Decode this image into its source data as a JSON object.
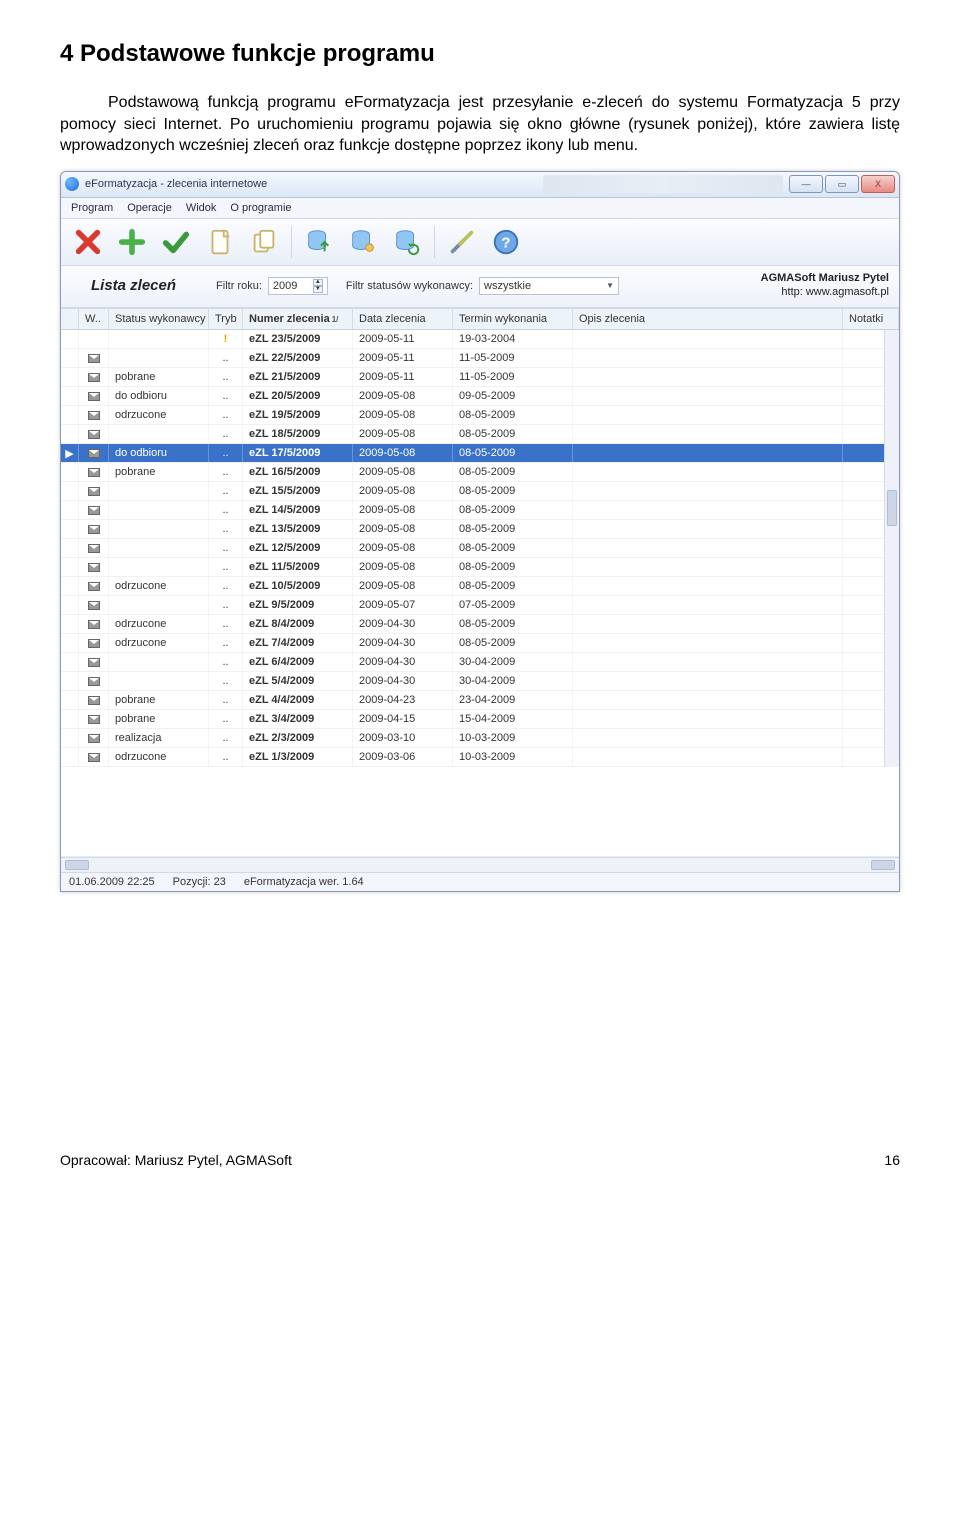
{
  "section": {
    "heading": "4  Podstawowe funkcje programu",
    "paragraph": "Podstawową funkcją programu eFormatyzacja jest przesyłanie e-zleceń do systemu Formatyzacja 5 przy pomocy sieci Internet.\nPo uruchomieniu programu pojawia się okno główne (rysunek poniżej), które zawiera listę wprowadzonych wcześniej zleceń oraz funkcje dostępne poprzez ikony lub menu."
  },
  "window": {
    "title": "eFormatyzacja - zlecenia internetowe",
    "menubar": [
      "Program",
      "Operacje",
      "Widok",
      "O programie"
    ],
    "win_buttons": {
      "min": "—",
      "max": "▭",
      "close": "X"
    },
    "toolbar_icons": [
      "close-icon",
      "add-icon",
      "confirm-icon",
      "page-icon",
      "copy-icon",
      "db-up-icon",
      "db-users-icon",
      "db-refresh-icon",
      "tools-icon",
      "help-icon"
    ],
    "filter": {
      "heading": "Lista zleceń",
      "year_label": "Filtr roku:",
      "year_value": "2009",
      "status_label": "Filtr statusów wykonawcy:",
      "status_value": "wszystkie"
    },
    "brand": {
      "name": "AGMASoft Mariusz Pytel",
      "url": "http: www.agmasoft.pl"
    },
    "columns": [
      {
        "key": "ind",
        "label": "",
        "w": "col-ind"
      },
      {
        "key": "w",
        "label": "W..",
        "w": "col-w"
      },
      {
        "key": "status",
        "label": "Status wykonawcy",
        "w": "col-status"
      },
      {
        "key": "tryb",
        "label": "Tryb",
        "w": "col-tryb"
      },
      {
        "key": "num",
        "label": "Numer zlecenia",
        "w": "col-num",
        "sort": "1/"
      },
      {
        "key": "date",
        "label": "Data zlecenia",
        "w": "col-date"
      },
      {
        "key": "term",
        "label": "Termin wykonania",
        "w": "col-term"
      },
      {
        "key": "opis",
        "label": "Opis zlecenia",
        "w": "col-opis"
      },
      {
        "key": "not",
        "label": "Notatki",
        "w": "col-not"
      }
    ],
    "rows": [
      {
        "w": "",
        "status": "",
        "trybWarn": true,
        "num": "eZL 23/5/2009",
        "date": "2009-05-11",
        "term": "19-03-2004"
      },
      {
        "w": "env",
        "status": "",
        "num": "eZL 22/5/2009",
        "date": "2009-05-11",
        "term": "11-05-2009"
      },
      {
        "w": "env",
        "status": "pobrane",
        "num": "eZL 21/5/2009",
        "date": "2009-05-11",
        "term": "11-05-2009"
      },
      {
        "w": "env",
        "status": "do odbioru",
        "num": "eZL 20/5/2009",
        "date": "2009-05-08",
        "term": "09-05-2009"
      },
      {
        "w": "env",
        "status": "odrzucone",
        "num": "eZL 19/5/2009",
        "date": "2009-05-08",
        "term": "08-05-2009"
      },
      {
        "w": "env",
        "status": "",
        "num": "eZL 18/5/2009",
        "date": "2009-05-08",
        "term": "08-05-2009"
      },
      {
        "ind": "▶",
        "w": "env",
        "status": "do odbioru",
        "num": "eZL 17/5/2009",
        "date": "2009-05-08",
        "term": "08-05-2009",
        "sel": true
      },
      {
        "w": "env",
        "status": "pobrane",
        "num": "eZL 16/5/2009",
        "date": "2009-05-08",
        "term": "08-05-2009"
      },
      {
        "w": "env",
        "status": "",
        "num": "eZL 15/5/2009",
        "date": "2009-05-08",
        "term": "08-05-2009"
      },
      {
        "w": "env",
        "status": "",
        "num": "eZL 14/5/2009",
        "date": "2009-05-08",
        "term": "08-05-2009"
      },
      {
        "w": "env",
        "status": "",
        "num": "eZL 13/5/2009",
        "date": "2009-05-08",
        "term": "08-05-2009"
      },
      {
        "w": "env",
        "status": "",
        "num": "eZL 12/5/2009",
        "date": "2009-05-08",
        "term": "08-05-2009"
      },
      {
        "w": "env",
        "status": "",
        "num": "eZL 11/5/2009",
        "date": "2009-05-08",
        "term": "08-05-2009"
      },
      {
        "w": "env",
        "status": "odrzucone",
        "num": "eZL 10/5/2009",
        "date": "2009-05-08",
        "term": "08-05-2009"
      },
      {
        "w": "env",
        "status": "",
        "num": "eZL 9/5/2009",
        "date": "2009-05-07",
        "term": "07-05-2009"
      },
      {
        "w": "env",
        "status": "odrzucone",
        "num": "eZL 8/4/2009",
        "date": "2009-04-30",
        "term": "08-05-2009"
      },
      {
        "w": "env",
        "status": "odrzucone",
        "num": "eZL 7/4/2009",
        "date": "2009-04-30",
        "term": "08-05-2009"
      },
      {
        "w": "env",
        "status": "",
        "num": "eZL 6/4/2009",
        "date": "2009-04-30",
        "term": "30-04-2009"
      },
      {
        "w": "env",
        "status": "",
        "num": "eZL 5/4/2009",
        "date": "2009-04-30",
        "term": "30-04-2009"
      },
      {
        "w": "env",
        "status": "pobrane",
        "num": "eZL 4/4/2009",
        "date": "2009-04-23",
        "term": "23-04-2009"
      },
      {
        "w": "env",
        "status": "pobrane",
        "num": "eZL 3/4/2009",
        "date": "2009-04-15",
        "term": "15-04-2009"
      },
      {
        "w": "env",
        "status": "realizacja",
        "num": "eZL 2/3/2009",
        "date": "2009-03-10",
        "term": "10-03-2009"
      },
      {
        "w": "env",
        "status": "odrzucone",
        "num": "eZL 1/3/2009",
        "date": "2009-03-06",
        "term": "10-03-2009"
      }
    ],
    "statusbar": {
      "datetime": "01.06.2009 22:25",
      "count": "Pozycji: 23",
      "version": "eFormatyzacja wer. 1.64"
    }
  },
  "footer": {
    "author": "Opracował: Mariusz Pytel, AGMASoft",
    "page": "16"
  }
}
